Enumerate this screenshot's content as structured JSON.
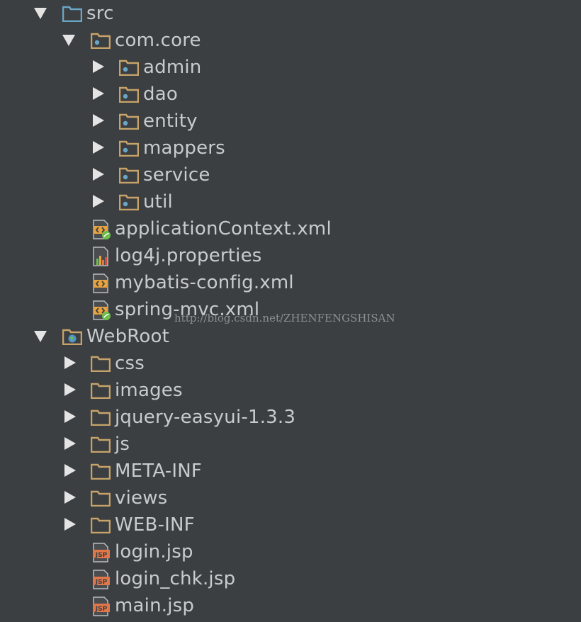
{
  "colors": {
    "background": "#3c3f41",
    "text": "#c8cbcf",
    "folder": "#c7a36a",
    "source_folder": "#6aa6c8",
    "xml_icon": "#e8a33d",
    "jsp_icon": "#e0774a",
    "spring_leaf": "#6cbf4a"
  },
  "tree": {
    "src": {
      "label": "src",
      "icon": "source-folder-icon",
      "expanded": true
    },
    "com_core": {
      "label": "com.core",
      "icon": "package-icon",
      "expanded": true
    },
    "packages": [
      {
        "label": "admin",
        "icon": "package-icon"
      },
      {
        "label": "dao",
        "icon": "package-icon"
      },
      {
        "label": "entity",
        "icon": "package-icon"
      },
      {
        "label": "mappers",
        "icon": "package-icon"
      },
      {
        "label": "service",
        "icon": "package-icon"
      },
      {
        "label": "util",
        "icon": "package-icon"
      }
    ],
    "src_files": [
      {
        "label": "applicationContext.xml",
        "icon": "spring-xml-icon"
      },
      {
        "label": "log4j.properties",
        "icon": "properties-icon"
      },
      {
        "label": "mybatis-config.xml",
        "icon": "xml-icon"
      },
      {
        "label": "spring-mvc.xml",
        "icon": "spring-xml-icon"
      }
    ],
    "webroot": {
      "label": "WebRoot",
      "icon": "web-folder-icon",
      "expanded": true
    },
    "web_folders": [
      {
        "label": "css",
        "icon": "folder-icon"
      },
      {
        "label": "images",
        "icon": "folder-icon"
      },
      {
        "label": "jquery-easyui-1.3.3",
        "icon": "folder-icon"
      },
      {
        "label": "js",
        "icon": "folder-icon"
      },
      {
        "label": "META-INF",
        "icon": "folder-icon"
      },
      {
        "label": "views",
        "icon": "folder-icon"
      },
      {
        "label": "WEB-INF",
        "icon": "folder-icon"
      }
    ],
    "web_files": [
      {
        "label": "login.jsp",
        "icon": "jsp-icon"
      },
      {
        "label": "login_chk.jsp",
        "icon": "jsp-icon"
      },
      {
        "label": "main.jsp",
        "icon": "jsp-icon"
      }
    ]
  },
  "watermark": "http://blog.csdn.net/ZHENFENGSHISAN"
}
